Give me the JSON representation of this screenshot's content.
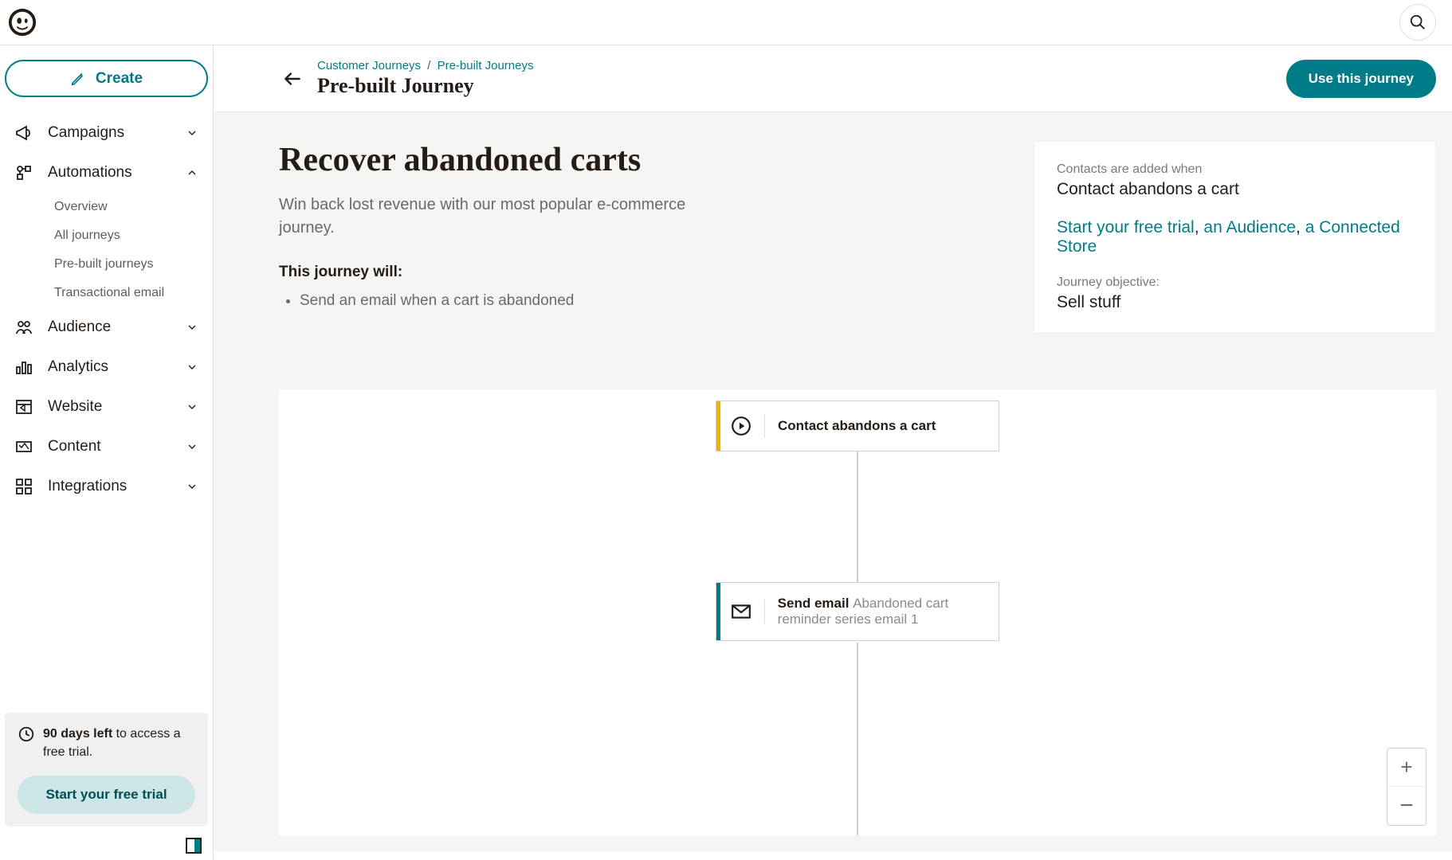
{
  "sidebar": {
    "create_label": "Create",
    "items": [
      {
        "label": "Campaigns",
        "expanded": false
      },
      {
        "label": "Automations",
        "expanded": true,
        "sub": [
          {
            "label": "Overview"
          },
          {
            "label": "All journeys"
          },
          {
            "label": "Pre-built journeys"
          },
          {
            "label": "Transactional email"
          }
        ]
      },
      {
        "label": "Audience",
        "expanded": false
      },
      {
        "label": "Analytics",
        "expanded": false
      },
      {
        "label": "Website",
        "expanded": false
      },
      {
        "label": "Content",
        "expanded": false
      },
      {
        "label": "Integrations",
        "expanded": false
      }
    ],
    "trial": {
      "days_left": "90 days left",
      "rest": " to access a free trial.",
      "cta": "Start your free trial"
    }
  },
  "header": {
    "breadcrumbs": {
      "a": "Customer Journeys",
      "b": "Pre-built Journeys"
    },
    "title": "Pre-built Journey",
    "use_button": "Use this journey"
  },
  "overview": {
    "title": "Recover abandoned carts",
    "subtitle": "Win back lost revenue with our most popular e-commerce journey.",
    "will_heading": "This journey will:",
    "will_items": [
      "Send an email when a cart is abandoned"
    ],
    "card": {
      "added_label": "Contacts are added when",
      "added_value": "Contact abandons a cart",
      "links": {
        "trial": "Start your free trial",
        "sep1": ", ",
        "audience": "an Audience",
        "sep2": ", ",
        "store": "a Connected Store"
      },
      "objective_label": "Journey objective:",
      "objective_value": "Sell stuff"
    }
  },
  "canvas": {
    "node1": {
      "title": "Contact abandons a cart"
    },
    "node2": {
      "action": "Send email ",
      "detail": "Abandoned cart reminder series email 1"
    }
  }
}
